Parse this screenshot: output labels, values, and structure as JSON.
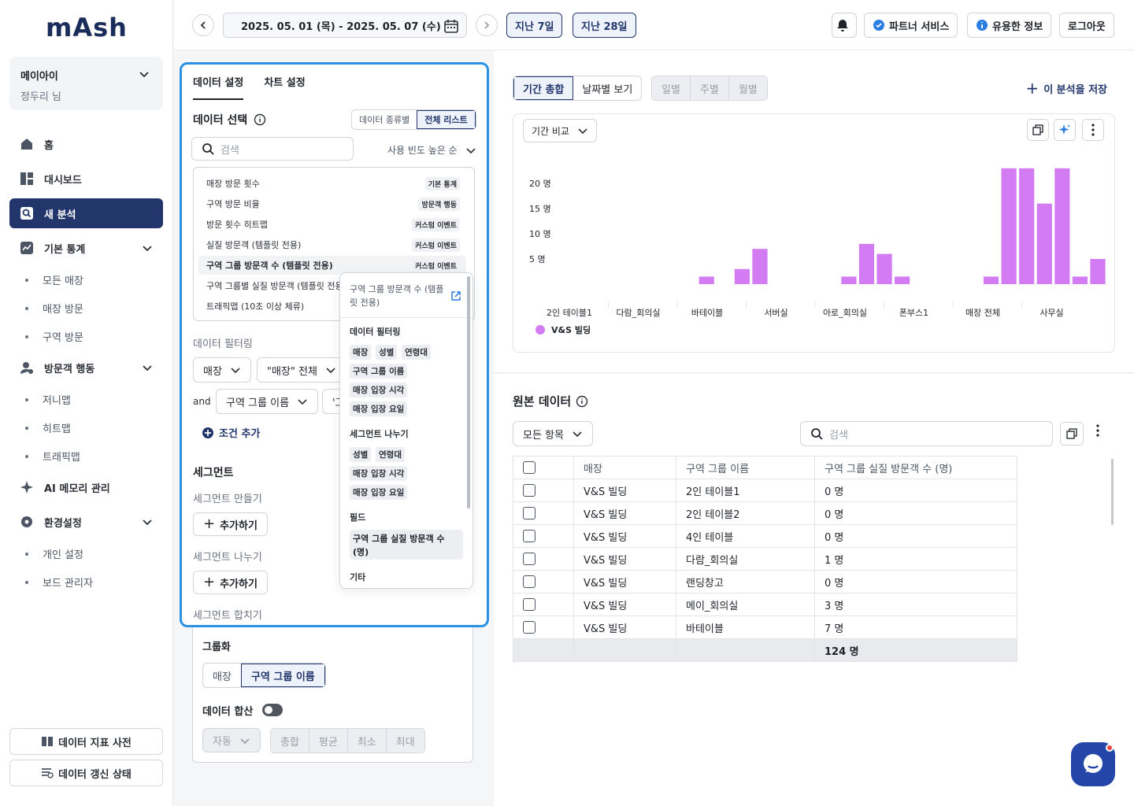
{
  "app": {
    "logo": "mAsh"
  },
  "account": {
    "name": "메이아이",
    "user": "정두리 님"
  },
  "nav": {
    "home": "홈",
    "dashboard": "대시보드",
    "new_analysis": "새 분석",
    "basic_stats": "기본 통계",
    "basic_stats_items": [
      "모든 매장",
      "매장 방문",
      "구역 방문"
    ],
    "visitor_behavior": "방문객 행동",
    "visitor_behavior_items": [
      "저니맵",
      "히트맵",
      "트래픽맵"
    ],
    "ai_memory": "AI 메모리 관리",
    "settings": "환경설정",
    "settings_items": [
      "개인 설정",
      "보드 관리자"
    ],
    "metric_dictionary": "데이터 지표 사전",
    "data_refresh": "데이터 갱신 상태"
  },
  "topbar": {
    "date_range": "2025. 05. 01 (목) - 2025. 05. 07 (수)",
    "last7": "지난 7일",
    "last28": "지난 28일",
    "partner": "파트너 서비스",
    "useful": "유용한 정보",
    "logout": "로그아웃"
  },
  "settings_panel": {
    "tabs": [
      "데이터 설정",
      "차트 설정"
    ],
    "data_select": "데이터 선택",
    "view_modes": [
      "데이터 종류별",
      "전체 리스트"
    ],
    "search_placeholder": "검색",
    "sort": "사용 빈도 높은 순",
    "metrics": [
      {
        "name": "매장 방문 횟수",
        "tag": "기본 통계"
      },
      {
        "name": "구역 방문 비율",
        "tag": "방문객 행동"
      },
      {
        "name": "방문 횟수 히트맵",
        "tag": "커스텀 이벤트"
      },
      {
        "name": "실질 방문객 (템플릿 전용)",
        "tag": "커스텀 이벤트"
      },
      {
        "name": "구역 그룹 방문객 수 (템플릿 전용)",
        "tag": "커스텀 이벤트"
      },
      {
        "name": "구역 그룹별 실질 방문객 (템플릿 전용)",
        "tag": ""
      },
      {
        "name": "트래픽맵 (10초 이상 체류)",
        "tag": ""
      }
    ],
    "filtering": "데이터 필터링",
    "filter1_field": "매장",
    "filter1_value": "\"매장\" 전체",
    "and": "and",
    "filter2_field": "구역 그룹 이름",
    "filter2_value": "'그",
    "add_condition": "조건 추가",
    "segment": "세그먼트",
    "segment_make": "세그먼트 만들기",
    "add": "추가하기",
    "segment_split": "세그먼트 나누기",
    "segment_merge": "세그먼트 합치기"
  },
  "popup": {
    "title": "구역 그룹 방문객 수 (템플릿 전용)",
    "filtering": "데이터 필터링",
    "filter_chips_row1": [
      "매장",
      "성별",
      "연령대"
    ],
    "filter_chips": [
      "구역 그룹 이름",
      "매장 입장 시각",
      "매장 입장 요일"
    ],
    "segment_split": "세그먼트 나누기",
    "segment_chips_row1": [
      "성별",
      "연령대"
    ],
    "segment_chips": [
      "매장 입장 시각",
      "매장 입장 요일"
    ],
    "field": "필드",
    "field_value": "구역 그룹 실질 방문객 수 (명)",
    "etc": "기타"
  },
  "grouping": {
    "title": "그룹화",
    "options": [
      "매장",
      "구역 그룹 이름"
    ],
    "sum_title": "데이터 합산",
    "auto": "자동",
    "agg": [
      "총합",
      "평균",
      "최소",
      "최대"
    ]
  },
  "chart_panel": {
    "view_tabs": [
      "기간 총합",
      "날짜별 보기"
    ],
    "period_tabs": [
      "일별",
      "주별",
      "월별"
    ],
    "save": "이 분석을 저장",
    "compare": "기간 비교"
  },
  "chart_data": {
    "type": "bar",
    "y_ticks": [
      "5 명",
      "10 명",
      "15 명",
      "20 명"
    ],
    "ylim": [
      0,
      24
    ],
    "categories": [
      "2인 테이블1",
      "다람_회의실",
      "바테이블",
      "서버실",
      "아로_회의실",
      "폰부스1",
      "매장 전체",
      "사무실"
    ],
    "series": [
      {
        "name": "V&S 빌딩",
        "color": "#d27bf2",
        "values": [
          0,
          0,
          0,
          0,
          0,
          0,
          0,
          0,
          1.5,
          0,
          3,
          7,
          0,
          0,
          0,
          0,
          1.5,
          8,
          6,
          1.5,
          0,
          0,
          0,
          0,
          1.5,
          23,
          23,
          16,
          23,
          1.5,
          5
        ]
      }
    ]
  },
  "raw_data": {
    "title": "원본 데이터",
    "filter": "모든 항목",
    "search_placeholder": "검색",
    "columns": [
      "매장",
      "구역 그룹 이름",
      "구역 그룹 실질 방문객 수 (명)"
    ],
    "rows": [
      [
        "V&S 빌딩",
        "2인 테이블1",
        "0 명"
      ],
      [
        "V&S 빌딩",
        "2인 테이블2",
        "0 명"
      ],
      [
        "V&S 빌딩",
        "4인 테이블",
        "0 명"
      ],
      [
        "V&S 빌딩",
        "다람_회의실",
        "1 명"
      ],
      [
        "V&S 빌딩",
        "랜딩창고",
        "0 명"
      ],
      [
        "V&S 빌딩",
        "메이_회의실",
        "3 명"
      ],
      [
        "V&S 빌딩",
        "바테이블",
        "7 명"
      ]
    ],
    "total": "124 명"
  }
}
